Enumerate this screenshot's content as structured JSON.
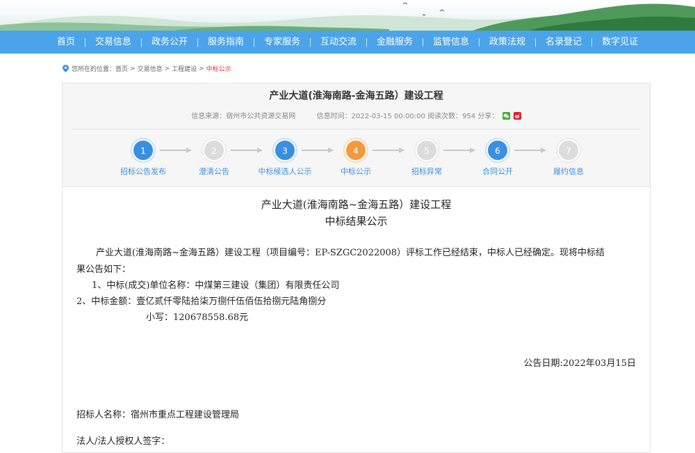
{
  "nav": {
    "items": [
      "首页",
      "交易信息",
      "政务公开",
      "服务指南",
      "专家服务",
      "互动交流",
      "金融服务",
      "监管信息",
      "政策法规",
      "名录登记",
      "数字见证"
    ]
  },
  "breadcrumb": {
    "prefix": "您所在的位置：",
    "items": [
      "首页",
      "交易信息",
      "工程建设"
    ],
    "separator": ">",
    "current": "中标公示"
  },
  "article": {
    "title": "产业大道(淮海南路-金海五路）建设工程",
    "source_label": "信息来源：",
    "source_value": "宿州市公共资源交易网",
    "time_label": "信息时间：",
    "time_value": "2022-03-15 00:00:00",
    "views_label": "阅读次数：",
    "views_value": "954",
    "share_label": "分享："
  },
  "steps": [
    {
      "num": "1",
      "label": "招标公告发布",
      "state": "blue"
    },
    {
      "num": "2",
      "label": "澄清公告",
      "state": "gray"
    },
    {
      "num": "3",
      "label": "中标候选人公示",
      "state": "blue"
    },
    {
      "num": "4",
      "label": "中标公示",
      "state": "orange"
    },
    {
      "num": "5",
      "label": "招标异常",
      "state": "gray"
    },
    {
      "num": "6",
      "label": "合同公开",
      "state": "blue"
    },
    {
      "num": "7",
      "label": "履约信息",
      "state": "gray"
    }
  ],
  "content": {
    "title_line1": "产业大道(淮海南路~金海五路）建设工程",
    "title_line2": "中标结果公示",
    "para_line1": "产业大道(淮海南路~金海五路）建设工程（项目编号：EP-SZGC2022008）评标工作已经结束，中标人已经确定。现将中标结",
    "para_line2": "果公告如下：",
    "item1": "1、中标(成交)单位名称：中煤第三建设（集团）有限责任公司",
    "item2": "2、中标金额：壹亿贰仟零陆拾柒万捌仟伍佰伍拾捌元陆角捌分",
    "item2_small": "小写：120678558.68元",
    "date_line": "公告日期:2022年03月15日",
    "tenderer": "招标人名称：宿州市重点工程建设管理局",
    "legal_rep": "法人/法人授权人签字："
  },
  "colors": {
    "nav_bg": "#4ba3ea",
    "step_blue": "#3b8fe0",
    "step_orange": "#f19a3e",
    "step_gray": "#dcdcdc",
    "breadcrumb_current": "#e0312b"
  }
}
